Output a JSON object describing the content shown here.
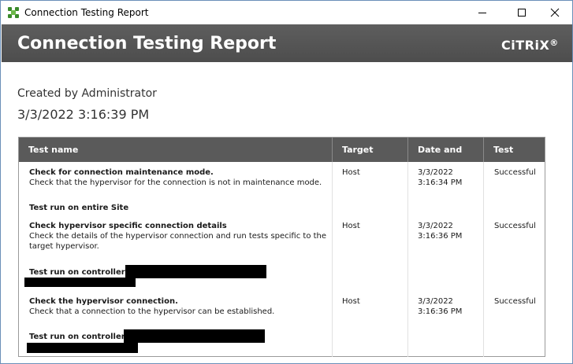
{
  "window": {
    "title": "Connection Testing Report",
    "controls": {
      "minimize": "—",
      "maximize": "☐",
      "close": "✕"
    }
  },
  "banner": {
    "title": "Connection Testing Report",
    "logo_text": "CiTRiX",
    "logo_mark": "®"
  },
  "meta": {
    "created_by": "Created by Administrator",
    "created_date": "3/3/2022 3:16:39 PM"
  },
  "table": {
    "headers": {
      "name": "Test name",
      "target": "Target Service",
      "date": "Date and time",
      "result": "Test result"
    },
    "rows": [
      {
        "name": "Check for connection maintenance mode.",
        "description": "Check that the hypervisor for the connection is not in maintenance mode.",
        "target": "Host",
        "date": "3/3/2022",
        "time": "3:16:34 PM",
        "result": "Successful",
        "scope": "Test run on entire Site"
      },
      {
        "name": "Check hypervisor specific connection details",
        "description_line1": "Check the details of the hypervisor connection and run tests specific to the",
        "description_line2": "target hypervisor.",
        "target": "Host",
        "date": "3/3/2022",
        "time": "3:16:36 PM",
        "result": "Successful",
        "scope": "Test run on controllers:"
      },
      {
        "name": "Check the hypervisor connection.",
        "description": "Check that a connection to the hypervisor can be established.",
        "target": "Host",
        "date": "3/3/2022",
        "time": "3:16:36 PM",
        "result": "Successful",
        "scope": "Test run on controllers:"
      }
    ]
  },
  "colors": {
    "banner": "#555555",
    "table_header": "#5a5a5a",
    "window_border": "#6b8fb8",
    "icon_green": "#3a8a2a"
  }
}
